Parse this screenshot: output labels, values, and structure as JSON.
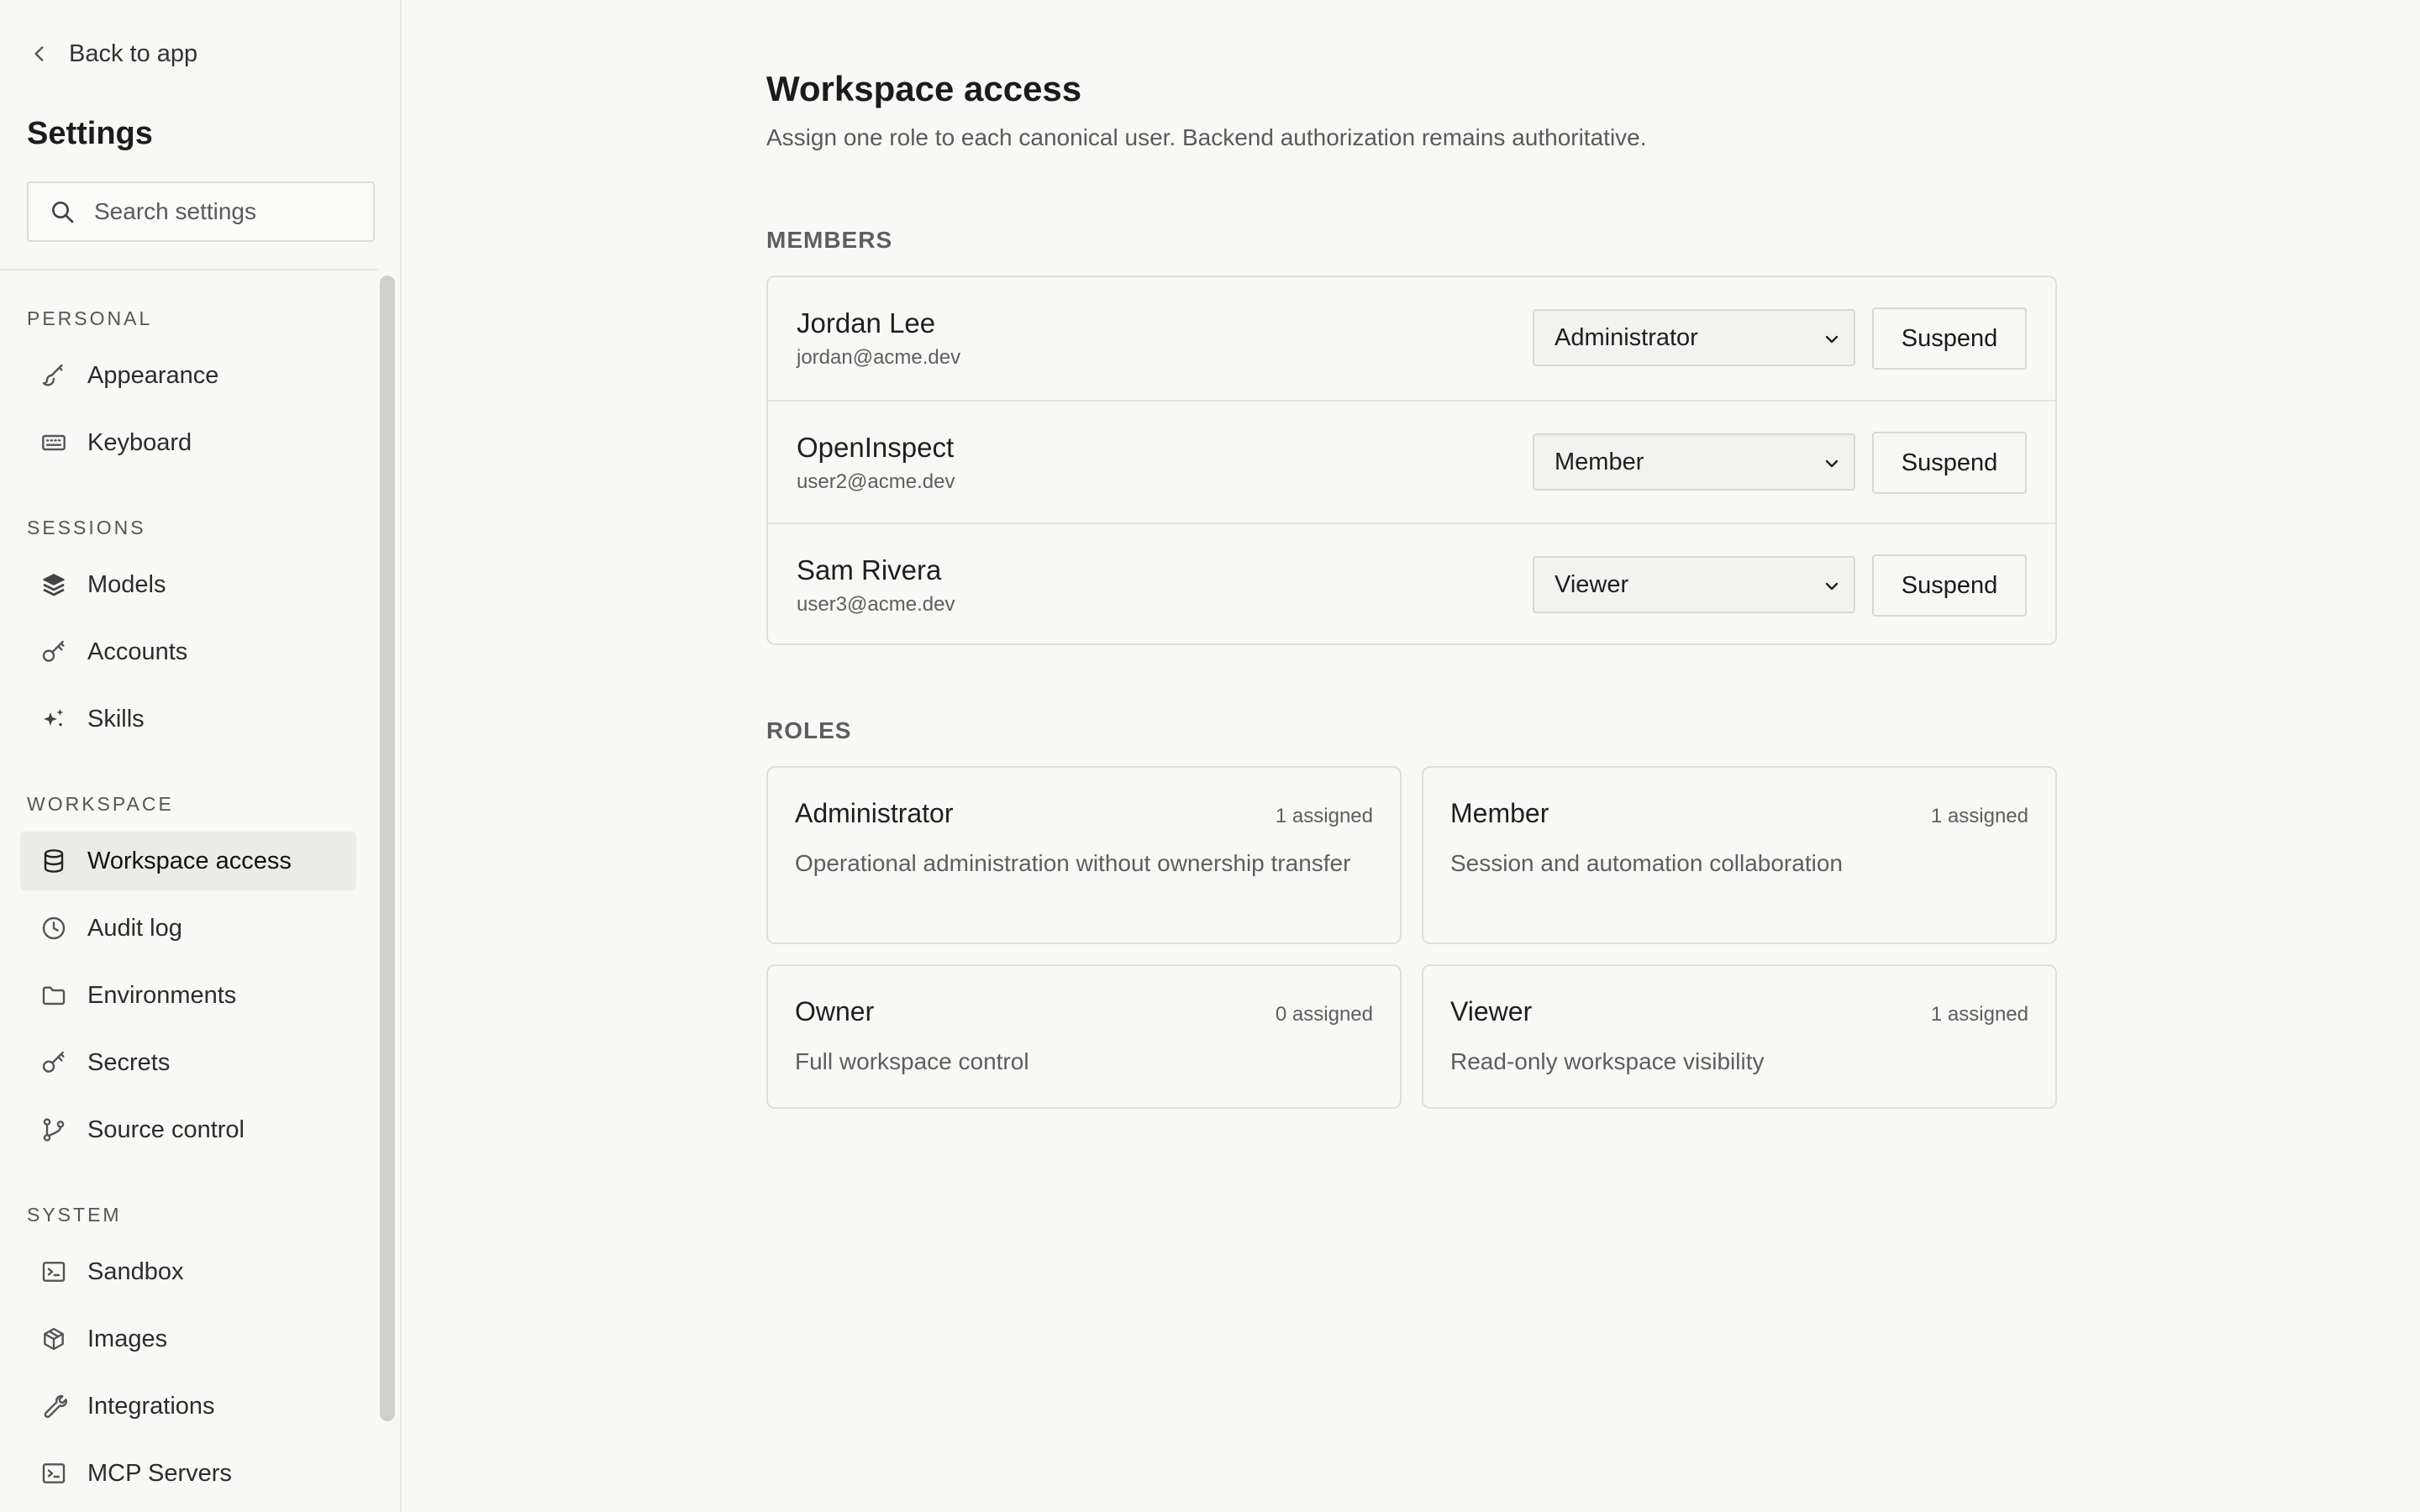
{
  "sidebar": {
    "back_label": "Back to app",
    "title": "Settings",
    "search": {
      "placeholder": "Search settings",
      "value": ""
    },
    "sections": [
      {
        "label": "PERSONAL",
        "items": [
          {
            "label": "Appearance",
            "icon": "brush-icon"
          },
          {
            "label": "Keyboard",
            "icon": "keyboard-icon"
          }
        ]
      },
      {
        "label": "SESSIONS",
        "items": [
          {
            "label": "Models",
            "icon": "layers-icon"
          },
          {
            "label": "Accounts",
            "icon": "key-icon"
          },
          {
            "label": "Skills",
            "icon": "sparkles-icon"
          }
        ]
      },
      {
        "label": "WORKSPACE",
        "items": [
          {
            "label": "Workspace access",
            "icon": "database-icon",
            "active": true
          },
          {
            "label": "Audit log",
            "icon": "clock-icon"
          },
          {
            "label": "Environments",
            "icon": "folder-icon"
          },
          {
            "label": "Secrets",
            "icon": "key-icon"
          },
          {
            "label": "Source control",
            "icon": "git-branch-icon"
          }
        ]
      },
      {
        "label": "SYSTEM",
        "items": [
          {
            "label": "Sandbox",
            "icon": "terminal-icon"
          },
          {
            "label": "Images",
            "icon": "box-icon"
          },
          {
            "label": "Integrations",
            "icon": "wrench-icon"
          },
          {
            "label": "MCP Servers",
            "icon": "terminal-icon"
          }
        ]
      }
    ]
  },
  "main": {
    "title": "Workspace access",
    "subtitle": "Assign one role to each canonical user. Backend authorization remains authoritative.",
    "members_label": "MEMBERS",
    "members": [
      {
        "name": "Jordan Lee",
        "email": "jordan@acme.dev",
        "role": "Administrator",
        "action": "Suspend"
      },
      {
        "name": "OpenInspect",
        "email": "user2@acme.dev",
        "role": "Member",
        "action": "Suspend"
      },
      {
        "name": "Sam Rivera",
        "email": "user3@acme.dev",
        "role": "Viewer",
        "action": "Suspend"
      }
    ],
    "roles_label": "ROLES",
    "roles": [
      {
        "name": "Administrator",
        "count": "1 assigned",
        "description": "Operational administration without ownership transfer"
      },
      {
        "name": "Member",
        "count": "1 assigned",
        "description": "Session and automation collaboration"
      },
      {
        "name": "Owner",
        "count": "0 assigned",
        "description": "Full workspace control"
      },
      {
        "name": "Viewer",
        "count": "1 assigned",
        "description": "Read-only workspace visibility"
      }
    ]
  }
}
